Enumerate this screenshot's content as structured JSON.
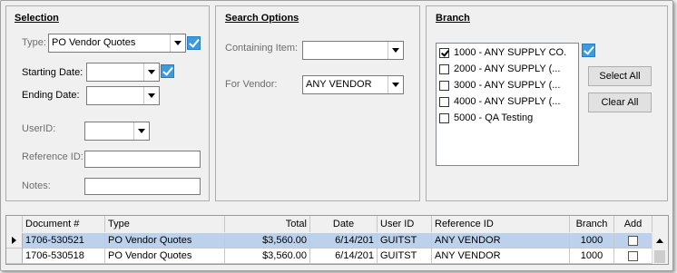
{
  "selection": {
    "title": "Selection",
    "type_label": "Type:",
    "type_value": "PO Vendor Quotes",
    "starting_date_label": "Starting Date:",
    "starting_date_value": "",
    "ending_date_label": "Ending Date:",
    "ending_date_value": "",
    "userid_label": "UserID:",
    "userid_value": "",
    "reference_label": "Reference ID:",
    "reference_value": "",
    "notes_label": "Notes:",
    "notes_value": ""
  },
  "search_options": {
    "title": "Search Options",
    "containing_label": "Containing Item:",
    "containing_value": "",
    "vendor_label": "For Vendor:",
    "vendor_value": "ANY VENDOR"
  },
  "branch": {
    "title": "Branch",
    "items": [
      {
        "label": "1000 - ANY SUPPLY CO.",
        "checked": true
      },
      {
        "label": "2000 - ANY SUPPLY (...",
        "checked": false
      },
      {
        "label": "3000 - ANY SUPPLY (...",
        "checked": false
      },
      {
        "label": "4000 - ANY SUPPLY (...",
        "checked": false
      },
      {
        "label": "5000 - QA Testing",
        "checked": false
      }
    ],
    "select_all_label": "Select All",
    "clear_all_label": "Clear All"
  },
  "grid": {
    "columns": [
      "Document #",
      "Type",
      "Total",
      "Date",
      "User ID",
      "Reference ID",
      "Branch",
      "Add"
    ],
    "rows": [
      {
        "document": "1706-530521",
        "type": "PO Vendor Quotes",
        "total": "$3,560.00",
        "date": "6/14/201",
        "user_id": "GUITST",
        "reference": "ANY VENDOR",
        "branch": "1000",
        "add": false
      },
      {
        "document": "1706-530518",
        "type": "PO Vendor Quotes",
        "total": "$3,560.00",
        "date": "6/14/201",
        "user_id": "GUITST",
        "reference": "ANY VENDOR",
        "branch": "1000",
        "add": false
      }
    ]
  },
  "colors": {
    "selected_row": "#bcd2ec",
    "check_blue": "#3c9be0"
  }
}
